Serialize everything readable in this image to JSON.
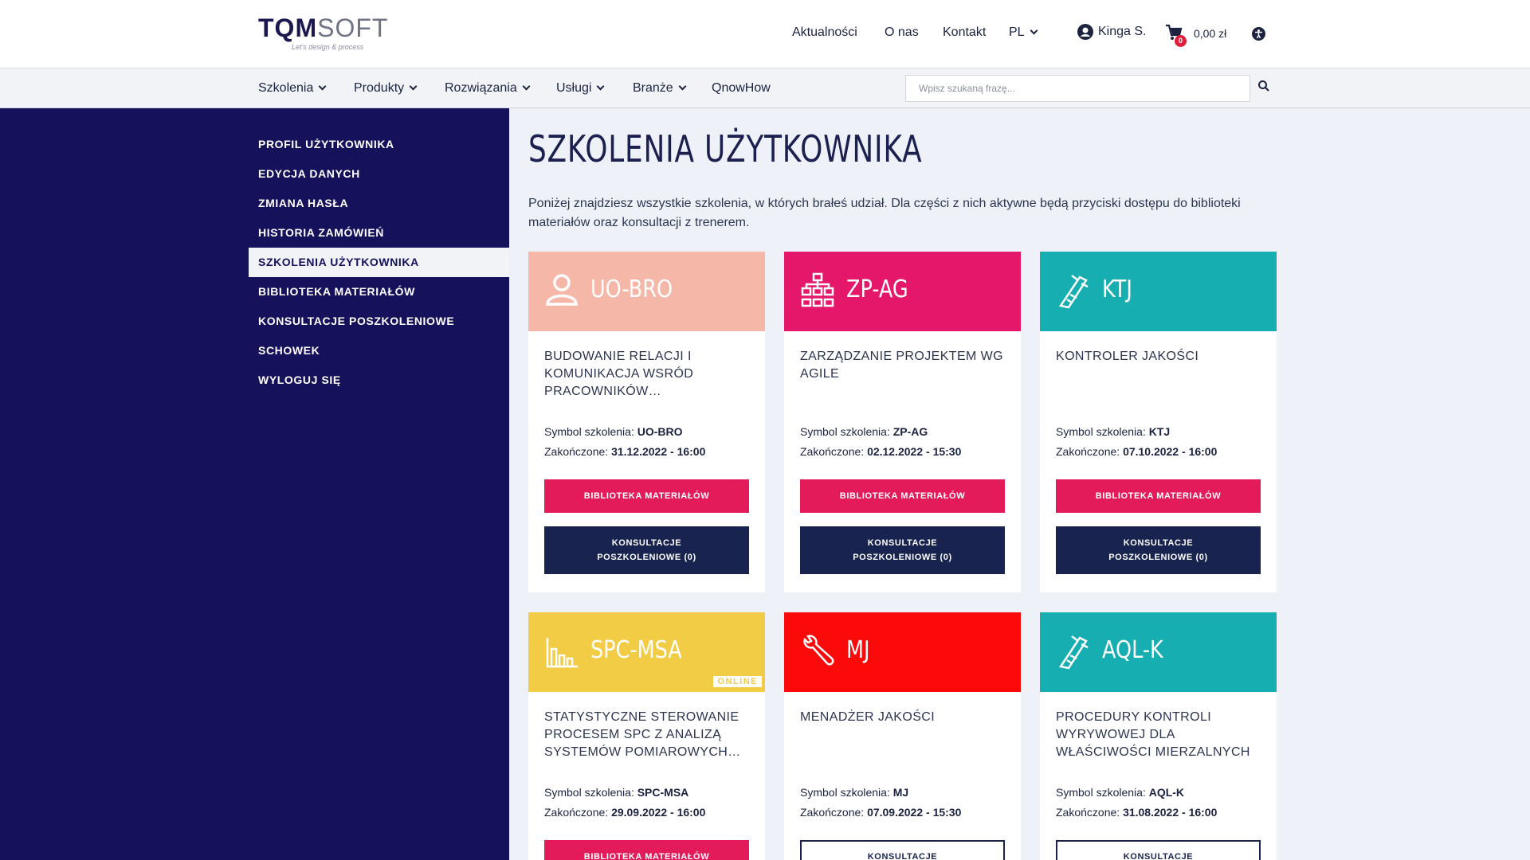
{
  "header": {
    "logo_text_a": "TQM",
    "logo_text_b": "SOFT",
    "logo_tagline": "Let's design & process",
    "nav": [
      "Aktualności",
      "O nas",
      "Kontakt"
    ],
    "lang": "PL",
    "user_name": "Kinga S.",
    "cart_count": "0",
    "cart_total": "0,00 zł"
  },
  "menu": {
    "items": [
      "Szkolenia",
      "Produkty",
      "Rozwiązania",
      "Usługi",
      "Branże",
      "QnowHow"
    ],
    "search_placeholder": "Wpisz szukaną frazę..."
  },
  "sidebar": {
    "items": [
      "PROFIL UŻYTKOWNIKA",
      "EDYCJA DANYCH",
      "ZMIANA HASŁA",
      "HISTORIA ZAMÓWIEŃ",
      "SZKOLENIA UŻYTKOWNIKA",
      "BIBLIOTEKA MATERIAŁÓW",
      "KONSULTACJE POSZKOLENIOWE",
      "SCHOWEK",
      "WYLOGUJ SIĘ"
    ],
    "active_index": 4
  },
  "main": {
    "title": "SZKOLENIA UŻYTKOWNIKA",
    "intro": "Poniżej znajdziesz wszystkie szkolenia, w których brałeś udział. Dla części z nich aktywne będą przyciski dostępu do biblioteki materiałów oraz konsultacji z trenerem.",
    "symbol_label": "Symbol szkolenia:",
    "finished_label": "Zakończone:",
    "btn_library": "BIBLIOTEKA MATERIAŁÓW",
    "btn_consult": "KONSULTACJE POSZKOLENIOWE (0)",
    "btn_consult_short": "KONSULTACJE",
    "online_label": "ONLINE"
  },
  "courses": [
    {
      "code": "UO-BRO",
      "title": "BUDOWANIE RELACJI I KOMUNIKACJA WSRÓD PRACOWNIKÓW…",
      "symbol": "UO-BRO",
      "finished": "31.12.2022 - 16:00",
      "color": "#f5b7a8",
      "icon": "user-icon"
    },
    {
      "code": "ZP-AG",
      "title": "ZARZĄDZANIE PROJEKTEM WG AGILE",
      "symbol": "ZP-AG",
      "finished": "02.12.2022 - 15:30",
      "color": "#e5176b",
      "icon": "hierarchy-icon"
    },
    {
      "code": "KTJ",
      "title": "KONTROLER JAKOŚCI",
      "symbol": "KTJ",
      "finished": "07.10.2022 - 16:00",
      "color": "#16aeb1",
      "icon": "caliper-icon"
    },
    {
      "code": "SPC-MSA",
      "title": "STATYSTYCZNE STEROWANIE PROCESEM SPC Z ANALIZĄ SYSTEMÓW POMIAROWYCH…",
      "symbol": "SPC-MSA",
      "finished": "29.09.2022 - 16:00",
      "color": "#f2cc45",
      "icon": "bar-chart-icon",
      "online": true
    },
    {
      "code": "MJ",
      "title": "MENADŻER JAKOŚCI",
      "symbol": "MJ",
      "finished": "07.09.2022 - 15:30",
      "color": "#fc0a0a",
      "icon": "wrench-icon"
    },
    {
      "code": "AQL-K",
      "title": "PROCEDURY KONTROLI WYRYWOWEJ DLA WŁAŚCIWOŚCI MIERZALNYCH",
      "symbol": "AQL-K",
      "finished": "31.08.2022 - 16:00",
      "color": "#16aeb1",
      "icon": "caliper-icon"
    }
  ]
}
